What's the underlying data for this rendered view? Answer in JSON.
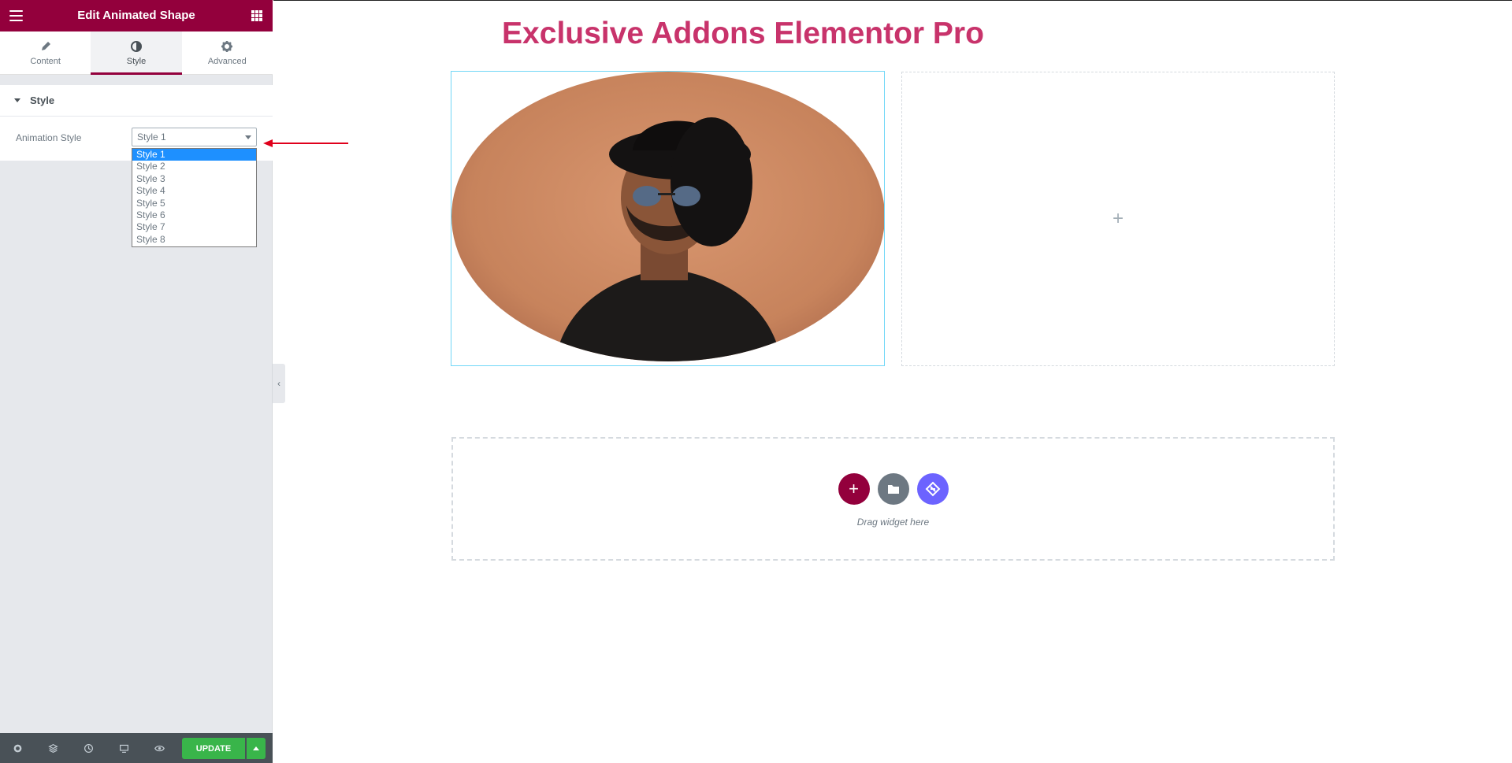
{
  "panel": {
    "title": "Edit Animated Shape",
    "tabs": [
      {
        "label": "Content",
        "icon": "pencil-icon"
      },
      {
        "label": "Style",
        "icon": "half-circle-icon"
      },
      {
        "label": "Advanced",
        "icon": "gear-icon"
      }
    ],
    "active_tab": "Style",
    "section_label": "Style",
    "control_label": "Animation Style",
    "select_value": "Style 1",
    "options": [
      "Style 1",
      "Style 2",
      "Style 3",
      "Style 4",
      "Style 5",
      "Style 6",
      "Style 7",
      "Style 8"
    ],
    "update_label": "UPDATE"
  },
  "canvas": {
    "title": "Exclusive Addons Elementor Pro",
    "empty_col_icon": "+",
    "drop_text": "Drag widget here"
  },
  "colors": {
    "brand": "#93003c",
    "title": "#c8336b",
    "update": "#39b54a",
    "selected_option": "#1e90ff",
    "annotation_arrow": "#e0001b"
  }
}
